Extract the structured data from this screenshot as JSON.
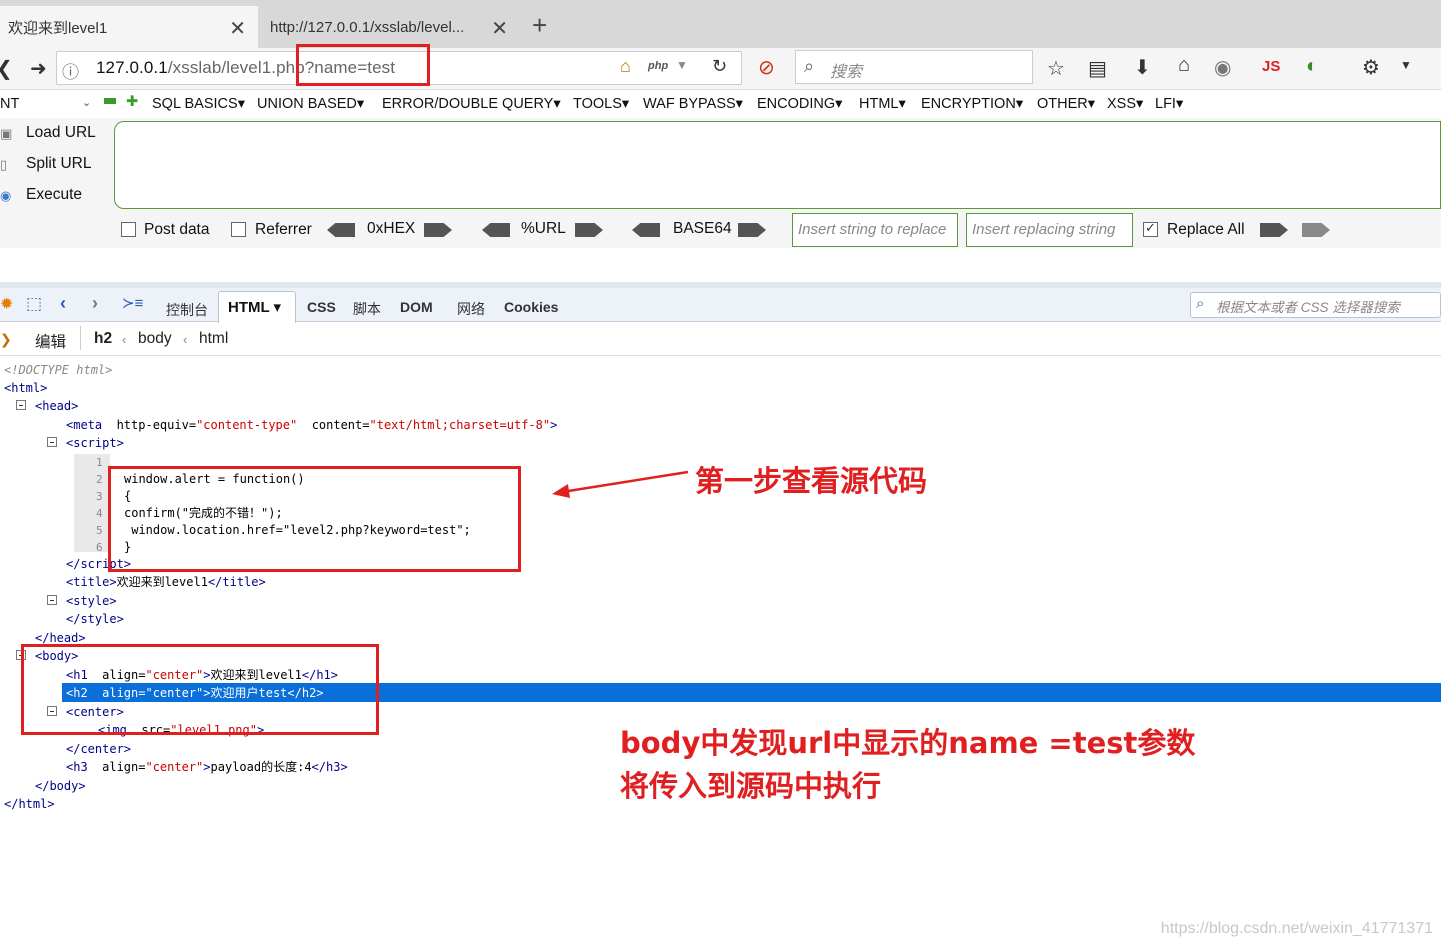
{
  "browser": {
    "tabs": [
      {
        "label": "欢迎来到level1",
        "active": true
      },
      {
        "label": "http://127.0.0.1/xsslab/level...",
        "active": false
      }
    ],
    "new_tab": "+",
    "url_host": "127.0.0.1",
    "url_path": "/xsslab/level1.php?name=test",
    "php_badge": "php",
    "search_placeholder": "搜索",
    "js_badge": "JS"
  },
  "hackbar": {
    "left_trunc": "NT",
    "menu": [
      "SQL BASICS",
      "UNION BASED",
      "ERROR/DOUBLE QUERY",
      "TOOLS",
      "WAF BYPASS",
      "ENCODING",
      "HTML",
      "ENCRYPTION",
      "OTHER",
      "XSS",
      "LFI"
    ],
    "actions": {
      "load": "Load URL",
      "split": "Split URL",
      "execute": "Execute"
    },
    "options": {
      "post": "Post data",
      "referrer": "Referrer",
      "hex": "0xHEX",
      "url": "%URL",
      "b64": "BASE64",
      "replace_all": "Replace All"
    },
    "insert_find_ph": "Insert string to replace",
    "insert_repl_ph": "Insert replacing string"
  },
  "firebug": {
    "tabs": [
      "控制台",
      "HTML",
      "CSS",
      "脚本",
      "DOM",
      "网络",
      "Cookies"
    ],
    "search_ph": "根据文本或者 CSS 选择器搜索",
    "edit": "编辑",
    "crumbs": [
      "h2",
      "body",
      "html"
    ]
  },
  "tree": {
    "doctype": "<!DOCTYPE html>",
    "script_lines": [
      "window.alert = function()",
      "{",
      "confirm(\"完成的不错！\");",
      " window.location.href=\"level2.php?keyword=test\";",
      "}"
    ],
    "title_text": "欢迎来到level1",
    "h1_text": "欢迎来到level1",
    "h2_text": "欢迎用户test",
    "img_src": "level1.png",
    "h3_text": "payload的长度:4",
    "meta_equiv": "content-type",
    "meta_content": "text/html;charset=utf-8"
  },
  "annotations": {
    "step1": "第一步查看源代码",
    "note_line1": "body中发现url中显示的name =test参数",
    "note_line2": "将传入到源码中执行",
    "annotation_color": "#e02020"
  },
  "watermark": "https://blog.csdn.net/weixin_41771371"
}
